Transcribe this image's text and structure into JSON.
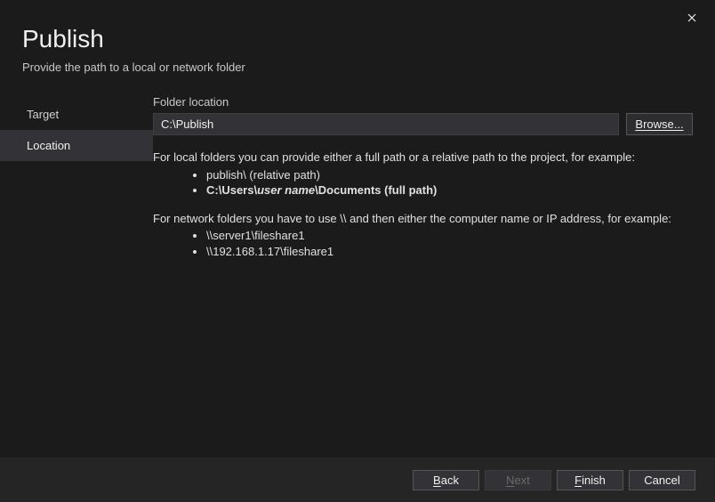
{
  "header": {
    "title": "Publish",
    "subtitle": "Provide the path to a local or network folder"
  },
  "steps": {
    "target": "Target",
    "location": "Location"
  },
  "form": {
    "folder_label": "Folder location",
    "folder_value": "C:\\Publish",
    "browse_label": "Browse..."
  },
  "help": {
    "local_intro": "For local folders you can provide either a full path or a relative path to the project, for example:",
    "local_ex1": "publish\\ (relative path)",
    "local_ex2_pre": "C:\\Users\\",
    "local_ex2_italic": "user name",
    "local_ex2_post": "\\Documents (full path)",
    "net_intro": "For network folders you have to use \\\\ and then either the computer name or IP address, for example:",
    "net_ex1": "\\\\server1\\fileshare1",
    "net_ex2": "\\\\192.168.1.17\\fileshare1"
  },
  "footer": {
    "back": "Back",
    "next": "Next",
    "finish": "Finish",
    "cancel": "Cancel"
  }
}
